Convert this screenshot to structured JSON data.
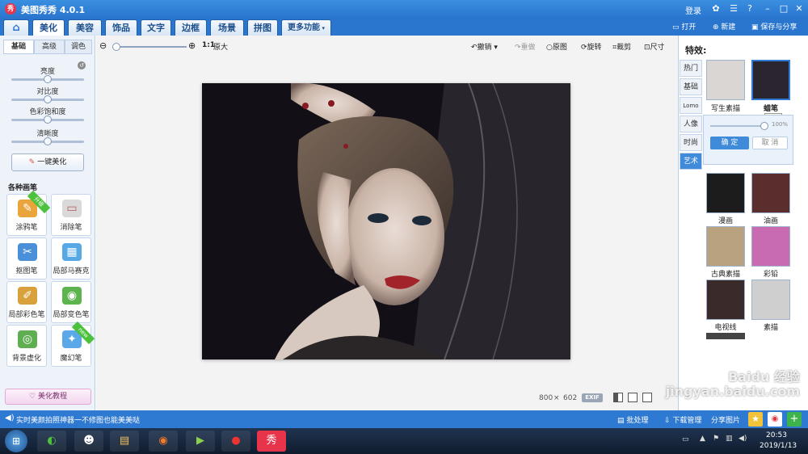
{
  "title": {
    "text": "美图秀秀 4.0.1",
    "login": "登录"
  },
  "menu": {
    "tabs": [
      "美化",
      "美容",
      "饰品",
      "文字",
      "边框",
      "场景",
      "拼图",
      "更多功能"
    ],
    "open": "打开",
    "new": "新建",
    "save": "保存与分享"
  },
  "left": {
    "subtabs": [
      "基础",
      "高级",
      "调色"
    ],
    "sliders": [
      {
        "label": "亮度",
        "level": 0.5
      },
      {
        "label": "对比度",
        "level": 0.5
      },
      {
        "label": "色彩饱和度",
        "level": 0.5
      },
      {
        "label": "清晰度",
        "level": 0.5
      }
    ],
    "auto_button": "一键美化",
    "section": "各种画笔",
    "tools": [
      {
        "label": "涂鸦笔",
        "badge": "升级",
        "icon": "pen-icon",
        "color": "#e9a43b"
      },
      {
        "label": "消除笔",
        "badge": "",
        "icon": "eraser-icon",
        "color": "#d9d9d9"
      },
      {
        "label": "抠图笔",
        "badge": "",
        "icon": "cutout-icon",
        "color": "#4a90d9"
      },
      {
        "label": "局部马赛克",
        "badge": "",
        "icon": "mosaic-icon",
        "color": "#57a9e6"
      },
      {
        "label": "局部彩色笔",
        "badge": "",
        "icon": "color-brush-icon",
        "color": "#d9a13c"
      },
      {
        "label": "局部变色笔",
        "badge": "",
        "icon": "bucket-icon",
        "color": "#5db34e"
      },
      {
        "label": "背景虚化",
        "badge": "",
        "icon": "blur-icon",
        "color": "#5fae52"
      },
      {
        "label": "魔幻笔",
        "badge": "new",
        "icon": "magic-pen-icon",
        "color": "#5aa8e8"
      }
    ],
    "tutorial": "美化教程"
  },
  "toolbar": {
    "zoom_ratio": "1:1",
    "zoom_fit": "原大",
    "undo": "撤销",
    "redo": "重做",
    "original": "原图",
    "rotate": "旋转",
    "crop": "裁剪",
    "size": "尺寸"
  },
  "image": {
    "width": "800",
    "sep": "×",
    "height": "602",
    "exif": "EXIF"
  },
  "right": {
    "title": "特效:",
    "categories": [
      "热门",
      "基础",
      "Lomo",
      "人像",
      "时尚",
      "艺术"
    ],
    "active_category": 5,
    "top_effects": [
      "写生素描",
      "蜡笔"
    ],
    "tooltip": "蜡笔",
    "strength": "100%",
    "confirm": "确 定",
    "cancel": "取 消",
    "effects": [
      "漫画",
      "油画",
      "古典素描",
      "彩铅",
      "电视线",
      "素描"
    ]
  },
  "status": {
    "message": "实时美颜拍照神器一不修图也能美美哒",
    "batch": "批处理",
    "download": "下载管理",
    "share": "分享图片"
  },
  "taskbar": {
    "time": "20:53",
    "date": "2019/1/13"
  },
  "watermark": "Baidu 经验 jingyan.baidu.com",
  "colors": {
    "brand": "#2a76cf",
    "accent": "#3f8ad9",
    "new_badge": "#4cc13b"
  }
}
